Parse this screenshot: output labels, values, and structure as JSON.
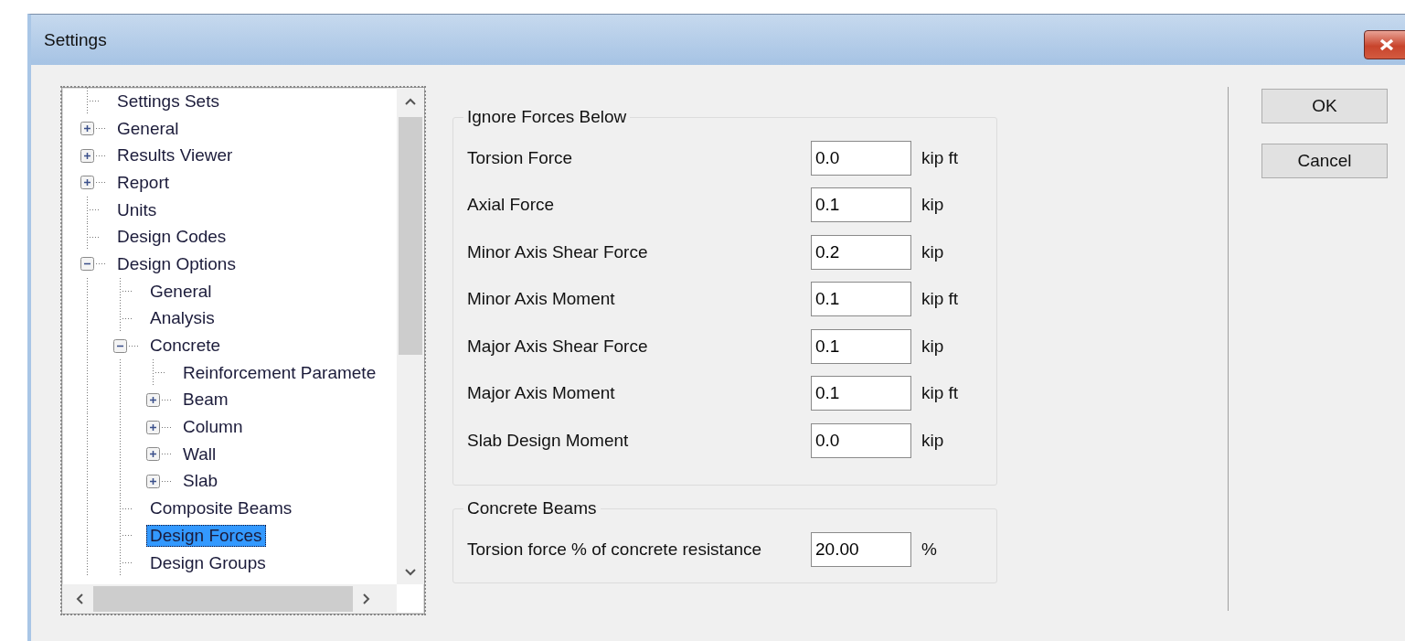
{
  "window": {
    "title": "Settings"
  },
  "tree": {
    "items": [
      {
        "label": "Settings Sets",
        "selected": false
      },
      {
        "label": "General",
        "expanded": false,
        "selected": false
      },
      {
        "label": "Results Viewer",
        "expanded": false,
        "selected": false
      },
      {
        "label": "Report",
        "expanded": false,
        "selected": false
      },
      {
        "label": "Units",
        "selected": false
      },
      {
        "label": "Design Codes",
        "selected": false
      },
      {
        "label": "Design Options",
        "expanded": true,
        "selected": false,
        "children": [
          {
            "label": "General",
            "selected": false
          },
          {
            "label": "Analysis",
            "selected": false
          },
          {
            "label": "Concrete",
            "expanded": true,
            "selected": false,
            "children": [
              {
                "label": "Reinforcement Paramete",
                "selected": false
              },
              {
                "label": "Beam",
                "expanded": false,
                "selected": false
              },
              {
                "label": "Column",
                "expanded": false,
                "selected": false
              },
              {
                "label": "Wall",
                "expanded": false,
                "selected": false
              },
              {
                "label": "Slab",
                "expanded": false,
                "selected": false
              }
            ]
          },
          {
            "label": "Composite Beams",
            "selected": false
          },
          {
            "label": "Design Forces",
            "selected": true
          },
          {
            "label": "Design Groups",
            "selected": false
          }
        ]
      }
    ]
  },
  "ignore_forces": {
    "title": "Ignore Forces Below",
    "rows": [
      {
        "label": "Torsion Force",
        "value": "0.0",
        "unit": "kip ft"
      },
      {
        "label": "Axial Force",
        "value": "0.1",
        "unit": "kip"
      },
      {
        "label": "Minor Axis Shear Force",
        "value": "0.2",
        "unit": "kip"
      },
      {
        "label": "Minor Axis Moment",
        "value": "0.1",
        "unit": "kip ft"
      },
      {
        "label": "Major Axis Shear Force",
        "value": "0.1",
        "unit": "kip"
      },
      {
        "label": "Major Axis Moment",
        "value": "0.1",
        "unit": "kip ft"
      },
      {
        "label": "Slab Design Moment",
        "value": "0.0",
        "unit": "kip"
      }
    ]
  },
  "concrete_beams": {
    "title": "Concrete Beams",
    "rows": [
      {
        "label": "Torsion force % of concrete resistance",
        "value": "20.00",
        "unit": "%"
      }
    ]
  },
  "buttons": [
    {
      "label": "OK"
    },
    {
      "label": "Cancel"
    }
  ]
}
